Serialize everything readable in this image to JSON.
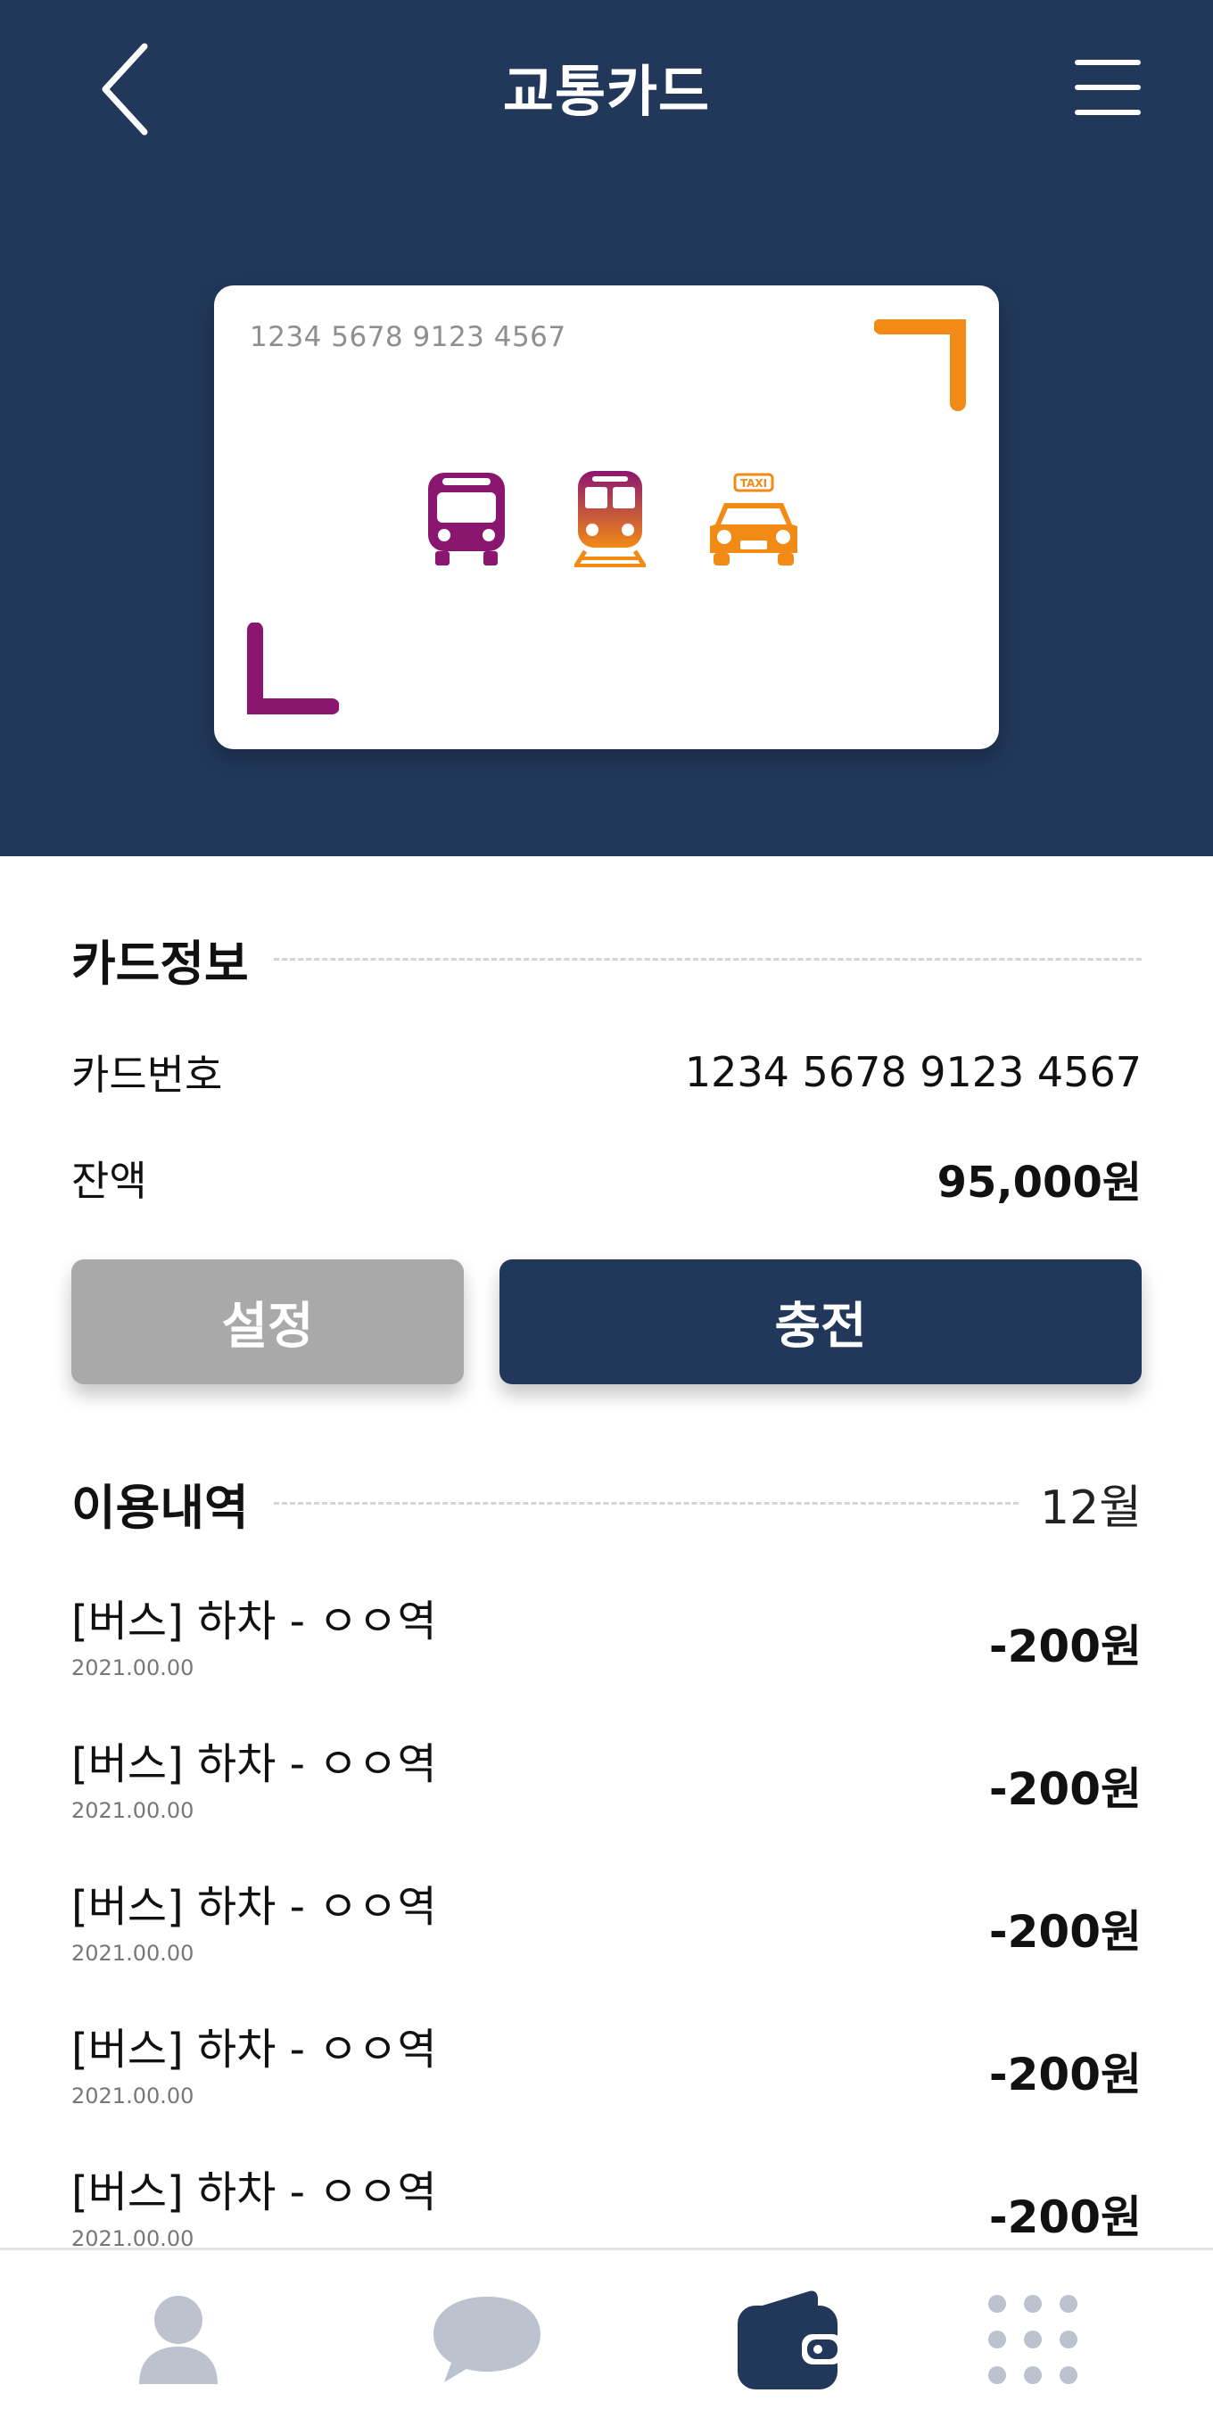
{
  "header": {
    "title": "교통카드",
    "back_icon": "chevron-left-icon",
    "menu_icon": "hamburger-menu-icon"
  },
  "card": {
    "number": "1234 5678 9123 4567",
    "transport_icons": [
      "bus-icon",
      "train-icon",
      "taxi-icon"
    ],
    "taxi_sign": "TAXI"
  },
  "card_info": {
    "section_title": "카드정보",
    "number_label": "카드번호",
    "number_value": "1234 5678 9123 4567",
    "balance_label": "잔액",
    "balance_value": "95,000원"
  },
  "actions": {
    "settings_label": "설정",
    "charge_label": "충전"
  },
  "history": {
    "section_title": "이용내역",
    "month": "12월",
    "items": [
      {
        "title": "[버스] 하차 - ㅇㅇ역",
        "date": "2021.00.00",
        "amount": "-200원"
      },
      {
        "title": "[버스] 하차 - ㅇㅇ역",
        "date": "2021.00.00",
        "amount": "-200원"
      },
      {
        "title": "[버스] 하차 - ㅇㅇ역",
        "date": "2021.00.00",
        "amount": "-200원"
      },
      {
        "title": "[버스] 하차 - ㅇㅇ역",
        "date": "2021.00.00",
        "amount": "-200원"
      },
      {
        "title": "[버스] 하차 - ㅇㅇ역",
        "date": "2021.00.00",
        "amount": "-200원"
      }
    ]
  },
  "bottom_nav": {
    "items": [
      {
        "icon": "profile-icon",
        "active": false
      },
      {
        "icon": "chat-icon",
        "active": false
      },
      {
        "icon": "wallet-icon",
        "active": true
      },
      {
        "icon": "apps-grid-icon",
        "active": false
      }
    ]
  },
  "colors": {
    "primary": "#21385a",
    "purple": "#8b1670",
    "orange": "#f28a16",
    "gray_button": "#a9a9a9",
    "nav_inactive": "#bcc3cf"
  }
}
